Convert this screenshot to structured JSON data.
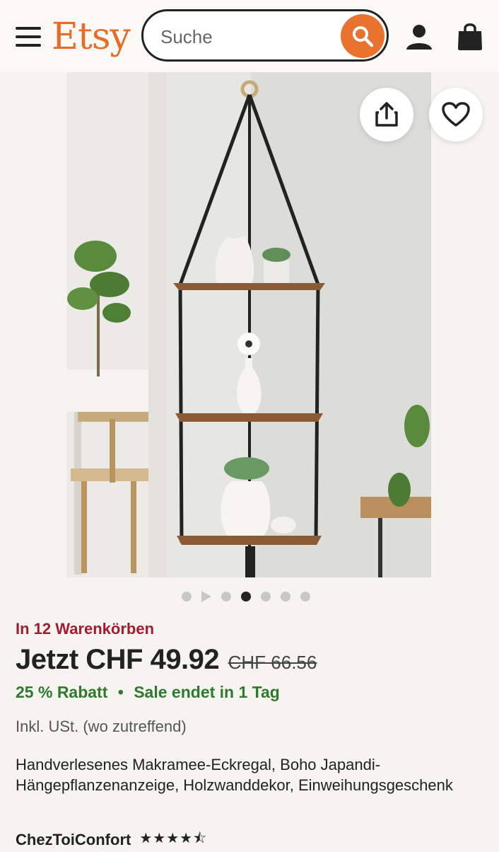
{
  "header": {
    "logo": "Etsy",
    "search_placeholder": "Suche"
  },
  "carousel": {
    "total_dots": 6,
    "active_index": 2
  },
  "product": {
    "carts_text": "In 12 Warenkörben",
    "price_now": "Jetzt CHF 49.92",
    "price_old": "CHF 66.56",
    "discount": "25 % Rabatt",
    "separator": "•",
    "sale_ends": "Sale endet in 1 Tag",
    "tax_note": "Inkl. USt. (wo zutreffend)",
    "title": "Handverlesenes Makramee-Eckregal, Boho Japandi-Hängepflanzenanzeige, Holzwanddekor, Einweihungsgeschenk",
    "shop_name": "ChezToiConfort",
    "rating": 4.5,
    "stars": "★★★★⯪"
  },
  "colors": {
    "brand": "#e56d2a",
    "search_button": "#e8722e",
    "carts_red": "#a61a2e",
    "sale_green": "#2f7a2f"
  },
  "icons": [
    "menu-icon",
    "search-icon",
    "user-icon",
    "bag-icon",
    "share-icon",
    "heart-icon",
    "play-icon"
  ]
}
